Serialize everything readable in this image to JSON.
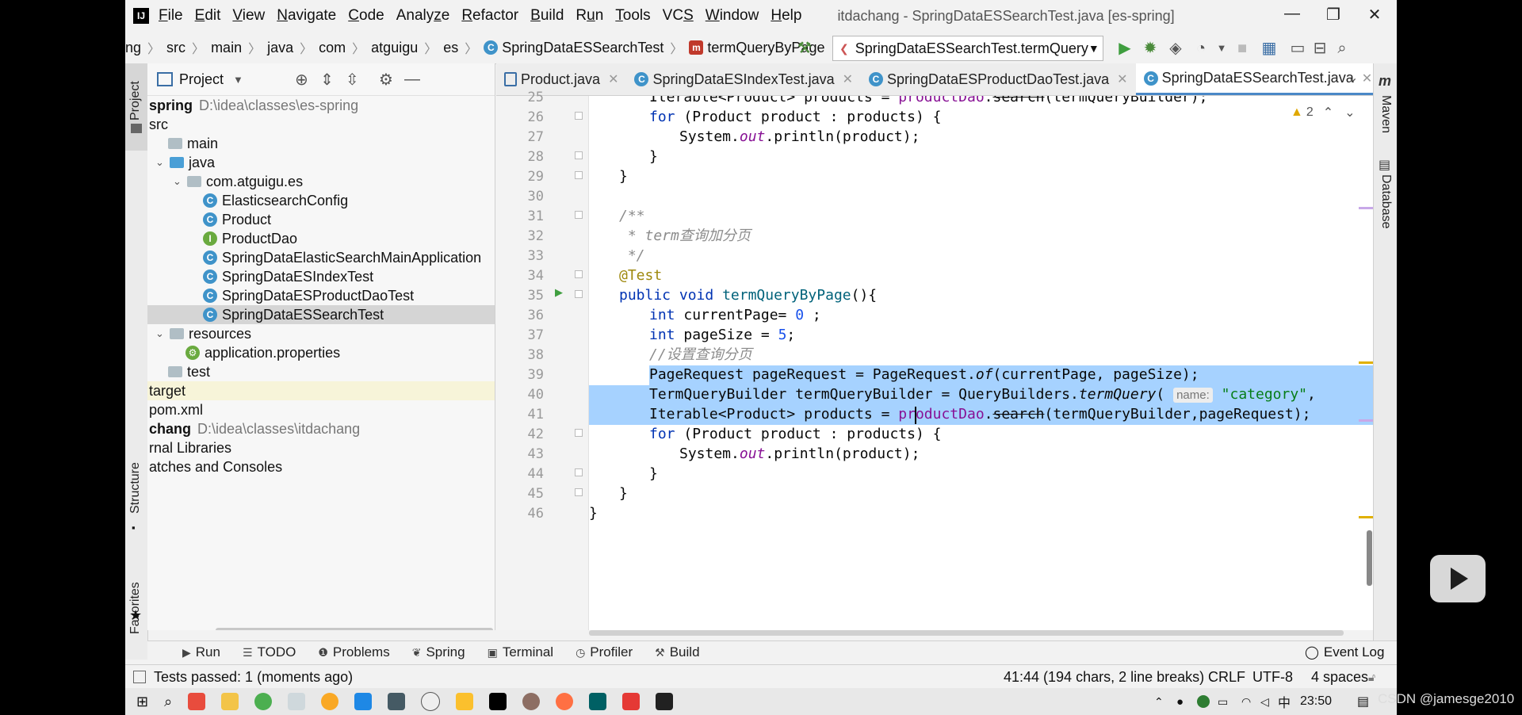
{
  "menu": [
    {
      "label": "File",
      "u": "F"
    },
    {
      "label": "Edit",
      "u": "E"
    },
    {
      "label": "View",
      "u": "V"
    },
    {
      "label": "Navigate",
      "u": "N"
    },
    {
      "label": "Code",
      "u": "C"
    },
    {
      "label": "Analyze",
      "u": "z"
    },
    {
      "label": "Refactor",
      "u": "R"
    },
    {
      "label": "Build",
      "u": "B"
    },
    {
      "label": "Run",
      "u": "u"
    },
    {
      "label": "Tools",
      "u": "T"
    },
    {
      "label": "VCS",
      "u": "S"
    },
    {
      "label": "Window",
      "u": "W"
    },
    {
      "label": "Help",
      "u": "H"
    }
  ],
  "window_title": "itdachang - SpringDataESSearchTest.java [es-spring]",
  "breadcrumbs": [
    "ng",
    "src",
    "main",
    "java",
    "com",
    "atguigu",
    "es",
    "SpringDataESSearchTest",
    "termQueryByPage"
  ],
  "run_config": "SpringDataESSearchTest.termQuery",
  "project_panel": {
    "title": "Project",
    "tree": [
      {
        "indent": 0,
        "icon": "",
        "label": "spring",
        "extra": "D:\\idea\\classes\\es-spring",
        "bold": true
      },
      {
        "indent": 0,
        "icon": "",
        "label": "src"
      },
      {
        "indent": 1,
        "icon": "folder",
        "label": "main"
      },
      {
        "indent": 1,
        "icon": "folder-blue",
        "label": "java",
        "arrow": "⌄"
      },
      {
        "indent": 2,
        "icon": "folder",
        "label": "com.atguigu.es",
        "arrow": "⌄"
      },
      {
        "indent": 3,
        "icon": "C",
        "label": "ElasticsearchConfig"
      },
      {
        "indent": 3,
        "icon": "C",
        "label": "Product"
      },
      {
        "indent": 3,
        "icon": "I",
        "label": "ProductDao"
      },
      {
        "indent": 3,
        "icon": "C",
        "label": "SpringDataElasticSearchMainApplication"
      },
      {
        "indent": 3,
        "icon": "C",
        "label": "SpringDataESIndexTest"
      },
      {
        "indent": 3,
        "icon": "C",
        "label": "SpringDataESProductDaoTest"
      },
      {
        "indent": 3,
        "icon": "C",
        "label": "SpringDataESSearchTest",
        "selected": true
      },
      {
        "indent": 1,
        "icon": "folder",
        "label": "resources",
        "arrow": "⌄"
      },
      {
        "indent": 2,
        "icon": "props",
        "label": "application.properties"
      },
      {
        "indent": 1,
        "icon": "folder",
        "label": "test"
      },
      {
        "indent": 0,
        "icon": "",
        "label": "target",
        "target": true
      },
      {
        "indent": 0,
        "icon": "",
        "label": "pom.xml"
      },
      {
        "indent": 0,
        "icon": "",
        "label": "chang",
        "extra": "D:\\idea\\classes\\itdachang",
        "bold": true
      },
      {
        "indent": 0,
        "icon": "",
        "label": "rnal Libraries"
      },
      {
        "indent": 0,
        "icon": "",
        "label": "atches and Consoles"
      }
    ]
  },
  "left_stripe": {
    "project": "Project",
    "structure": "Structure",
    "favorites": "Favorites"
  },
  "right_stripe": {
    "maven": "Maven",
    "database": "Database"
  },
  "tabs": [
    {
      "label": "Product.java",
      "active": false
    },
    {
      "label": "SpringDataESIndexTest.java",
      "active": false
    },
    {
      "label": "SpringDataESProductDaoTest.java",
      "active": false
    },
    {
      "label": "SpringDataESSearchTest.java",
      "active": true
    }
  ],
  "warnings_count": "2",
  "line_numbers": [
    "25",
    "26",
    "27",
    "28",
    "29",
    "30",
    "31",
    "32",
    "33",
    "34",
    "35",
    "36",
    "37",
    "38",
    "39",
    "40",
    "41",
    "42",
    "43",
    "44",
    "45",
    "46"
  ],
  "bottom_tools": [
    "Run",
    "TODO",
    "Problems",
    "Spring",
    "Terminal",
    "Profiler",
    "Build"
  ],
  "event_log": "Event Log",
  "status": {
    "message": "Tests passed: 1 (moments ago)",
    "position": "41:44 (194 chars, 2 line breaks)",
    "line_sep": "CRLF",
    "encoding": "UTF-8",
    "indent": "4 spaces"
  },
  "taskbar": {
    "time": "23:50",
    "ime": "中"
  },
  "watermark": "CSDN @jamesge2010"
}
